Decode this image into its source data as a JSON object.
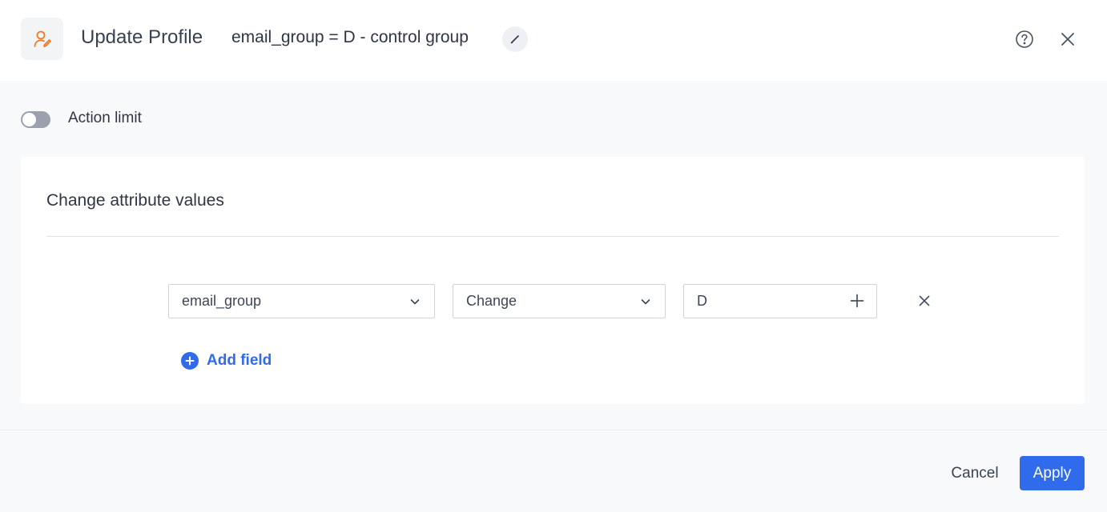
{
  "header": {
    "title": "Update Profile",
    "subtitle": "email_group = D - control group",
    "icon": "user-edit-icon",
    "accent_color": "#f07a2a"
  },
  "action_limit": {
    "label": "Action limit",
    "enabled": false
  },
  "card": {
    "title": "Change attribute values",
    "row": {
      "attribute": "email_group",
      "operation": "Change",
      "value": "D"
    },
    "add_field_label": "Add field"
  },
  "footer": {
    "cancel_label": "Cancel",
    "apply_label": "Apply"
  },
  "colors": {
    "primary": "#2f6bea",
    "toggle_off": "#9aa1ad"
  }
}
